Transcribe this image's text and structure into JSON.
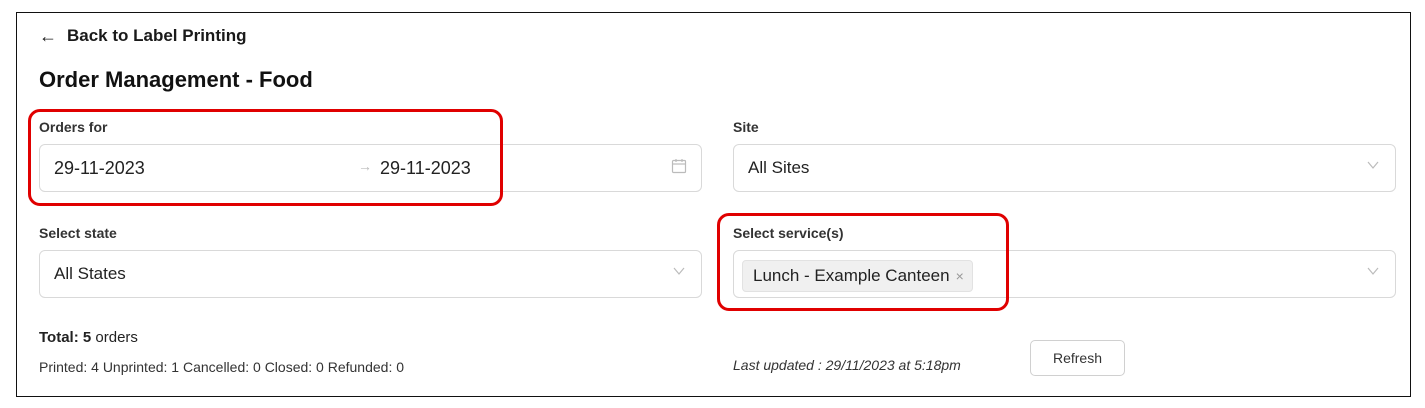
{
  "header": {
    "back_label": "Back to Label Printing",
    "title": "Order Management - Food"
  },
  "filters": {
    "orders_for": {
      "label": "Orders for",
      "start": "29-11-2023",
      "separator": "→",
      "end": "29-11-2023"
    },
    "site": {
      "label": "Site",
      "value": "All Sites"
    },
    "state": {
      "label": "Select state",
      "value": "All States"
    },
    "services": {
      "label": "Select service(s)",
      "tags": [
        "Lunch - Example Canteen"
      ],
      "remove_glyph": "×"
    }
  },
  "summary": {
    "total_label": "Total:",
    "total_count": "5",
    "total_unit": "orders",
    "breakdown": "Printed: 4 Unprinted: 1 Cancelled: 0 Closed: 0 Refunded: 0"
  },
  "status": {
    "last_updated": "Last updated : 29/11/2023 at 5:18pm",
    "refresh_label": "Refresh"
  },
  "colors": {
    "highlight": "#e00000",
    "border": "#d9d9d9"
  }
}
